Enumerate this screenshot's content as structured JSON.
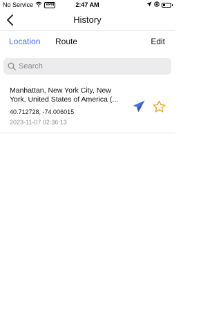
{
  "status_bar": {
    "carrier": "No Service",
    "vpn": "VPN",
    "time": "2:47 AM"
  },
  "nav": {
    "title": "History",
    "back_icon": "chevron-left-icon"
  },
  "tabs": [
    {
      "label": "Location",
      "active": true
    },
    {
      "label": "Route",
      "active": false
    }
  ],
  "edit_label": "Edit",
  "search": {
    "placeholder": "Search",
    "value": ""
  },
  "history": [
    {
      "address": "Manhattan, New York City, New York, United States of America (...",
      "coordinates": "40.712728, -74.006015",
      "timestamp": "2023-11-07 02:36:13",
      "send_icon": "paper-plane-icon",
      "favorite_icon": "star-outline-icon"
    }
  ],
  "colors": {
    "accent": "#4a70d6",
    "star": "#f0a020",
    "muted_text": "#8e8e93",
    "search_bg": "#ececef"
  }
}
